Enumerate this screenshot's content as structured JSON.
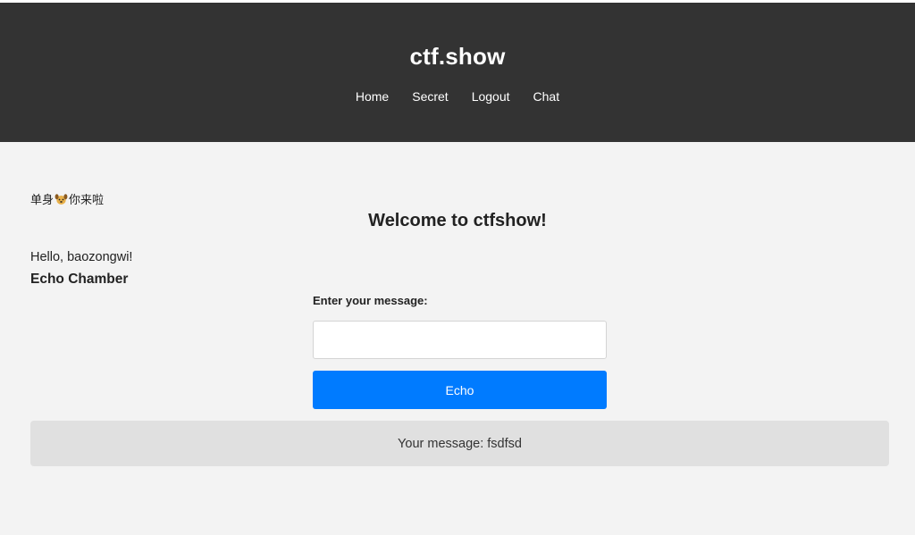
{
  "header": {
    "site_title": "ctf.show",
    "nav": [
      "Home",
      "Secret",
      "Logout",
      "Chat"
    ]
  },
  "main": {
    "banner_prefix": "单身",
    "banner_icon": "dog-icon",
    "banner_suffix": "你来啦",
    "welcome": "Welcome to ctfshow!",
    "greeting": "Hello, baozongwi!",
    "section_title": "Echo Chamber",
    "message_label": "Enter your message:",
    "message_value": "",
    "echo_button": "Echo",
    "result_text": "Your message: fsdfsd"
  },
  "colors": {
    "header_bg": "#333333",
    "page_bg": "#f3f3f3",
    "button_bg": "#007bff",
    "result_bg": "#e0e0e0"
  }
}
